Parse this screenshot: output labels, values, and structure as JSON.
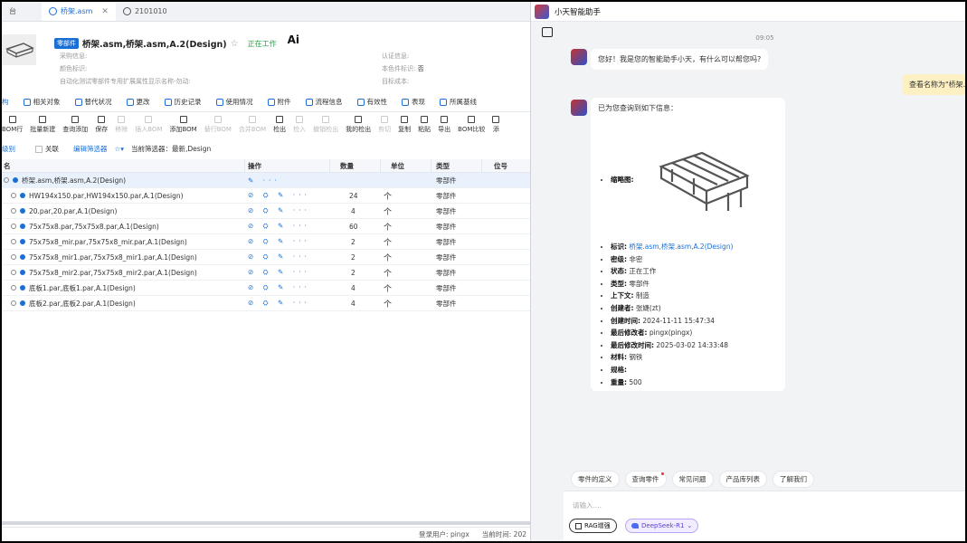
{
  "tabs": [
    {
      "label": "台",
      "active": false
    },
    {
      "label": "桥架.asm",
      "active": true
    },
    {
      "label": "2101010",
      "active": false
    }
  ],
  "part": {
    "badge": "零部件",
    "title": "桥架.asm,桥架.asm,A.2(Design)",
    "status": "正在工作",
    "ai": "Ai",
    "attrs": {
      "purchase": "采购信息:",
      "color_id": "颜色标识:",
      "auto_attr": "自动化测试零部件专用扩展属性显示名称-勿动:",
      "cert": "认证信息:",
      "local_color_label": "本色件标识:",
      "local_color_value": "否",
      "target_cost": "目标成本:"
    }
  },
  "section_tabs": [
    "构",
    "相关对象",
    "替代状况",
    "更改",
    "历史记录",
    "使用情况",
    "附件",
    "流程信息",
    "有效性",
    "表现",
    "所属基线"
  ],
  "toolbar": [
    {
      "label": "BOM行",
      "disabled": false
    },
    {
      "label": "批量新建",
      "disabled": false
    },
    {
      "label": "查询添加",
      "disabled": false
    },
    {
      "label": "保存",
      "disabled": false
    },
    {
      "label": "移除",
      "disabled": true
    },
    {
      "label": "插入BOM",
      "disabled": true
    },
    {
      "label": "添加BOM",
      "disabled": false
    },
    {
      "label": "替行BOM",
      "disabled": true
    },
    {
      "label": "合并BOM",
      "disabled": true
    },
    {
      "label": "检出",
      "disabled": false
    },
    {
      "label": "检入",
      "disabled": true
    },
    {
      "label": "撤销检出",
      "disabled": true
    },
    {
      "label": "我的检出",
      "disabled": false
    },
    {
      "label": "剪切",
      "disabled": true
    },
    {
      "label": "复制",
      "disabled": false
    },
    {
      "label": "粘贴",
      "disabled": false
    },
    {
      "label": "导出",
      "disabled": false
    },
    {
      "label": "BOM比较",
      "disabled": false
    },
    {
      "label": "添",
      "disabled": false
    }
  ],
  "filter": {
    "level": "级别",
    "related": "关联",
    "edit_filter": "编辑筛选器",
    "current_filter": "当前筛选器：最新,Design"
  },
  "grid": {
    "headers": {
      "name": "名",
      "ops": "操作",
      "qty": "数量",
      "unit": "单位",
      "type": "类型",
      "pos": "位号"
    },
    "ops_glyphs": "⊘ ⛭ ✎ ···",
    "root_ops": "✎ ···",
    "rows": [
      {
        "name": "桥架.asm,桥架.asm,A.2(Design)",
        "qty": "",
        "unit": "",
        "type": "零部件",
        "root": true
      },
      {
        "name": "HW194x150.par,HW194x150.par,A.1(Design)",
        "qty": "24",
        "unit": "个",
        "type": "零部件"
      },
      {
        "name": "20.par,20.par,A.1(Design)",
        "qty": "4",
        "unit": "个",
        "type": "零部件"
      },
      {
        "name": "75x75x8.par,75x75x8.par,A.1(Design)",
        "qty": "60",
        "unit": "个",
        "type": "零部件"
      },
      {
        "name": "75x75x8_mir.par,75x75x8_mir.par,A.1(Design)",
        "qty": "2",
        "unit": "个",
        "type": "零部件"
      },
      {
        "name": "75x75x8_mir1.par,75x75x8_mir1.par,A.1(Design)",
        "qty": "2",
        "unit": "个",
        "type": "零部件"
      },
      {
        "name": "75x75x8_mir2.par,75x75x8_mir2.par,A.1(Design)",
        "qty": "2",
        "unit": "个",
        "type": "零部件"
      },
      {
        "name": "底板1.par,底板1.par,A.1(Design)",
        "qty": "4",
        "unit": "个",
        "type": "零部件"
      },
      {
        "name": "底板2.par,底板2.par,A.1(Design)",
        "qty": "4",
        "unit": "个",
        "type": "零部件"
      }
    ]
  },
  "footer": {
    "user": "登录用户:  pingx",
    "time": "当前时间:  202"
  },
  "assistant": {
    "title": "小天智能助手",
    "time": "09:05",
    "greeting": "您好！我是您的智能助手小天，有什么可以帮您吗?",
    "user_msg": "查看名称为\"桥架.asm",
    "info_title": "已为您查询到如下信息：",
    "info": {
      "thumb_label": "缩略图:",
      "id_label": "标识:",
      "id_value": "桥架.asm,桥架.asm,A.2(Design)",
      "secret_label": "密级:",
      "secret_value": "非密",
      "state_label": "状态:",
      "state_value": "正在工作",
      "type_label": "类型:",
      "type_value": "零部件",
      "context_label": "上下文:",
      "context_value": "制造",
      "creator_label": "创建者:",
      "creator_value": "张婕(zt)",
      "ctime_label": "创建时间:",
      "ctime_value": "2024-11-11 15:47:34",
      "modifier_label": "最后修改者:",
      "modifier_value": "pingx(pingx)",
      "mtime_label": "最后修改时间:",
      "mtime_value": "2025-03-02 14:33:48",
      "material_label": "材料:",
      "material_value": "钢铁",
      "spec_label": "规格:",
      "spec_value": "",
      "weight_label": "重量:",
      "weight_value": "500"
    },
    "quick": [
      "零件的定义",
      "查询零件",
      "常见问题",
      "产品库列表",
      "了解我们"
    ],
    "input_placeholder": "请输入....",
    "rag": "RAG增强",
    "model": "DeepSeek-R1"
  },
  "colors": {
    "accent": "#1a6fd6",
    "status_green": "#2aa148",
    "user_bubble": "#fdf0c2",
    "model_purple": "#5b3fd1"
  }
}
